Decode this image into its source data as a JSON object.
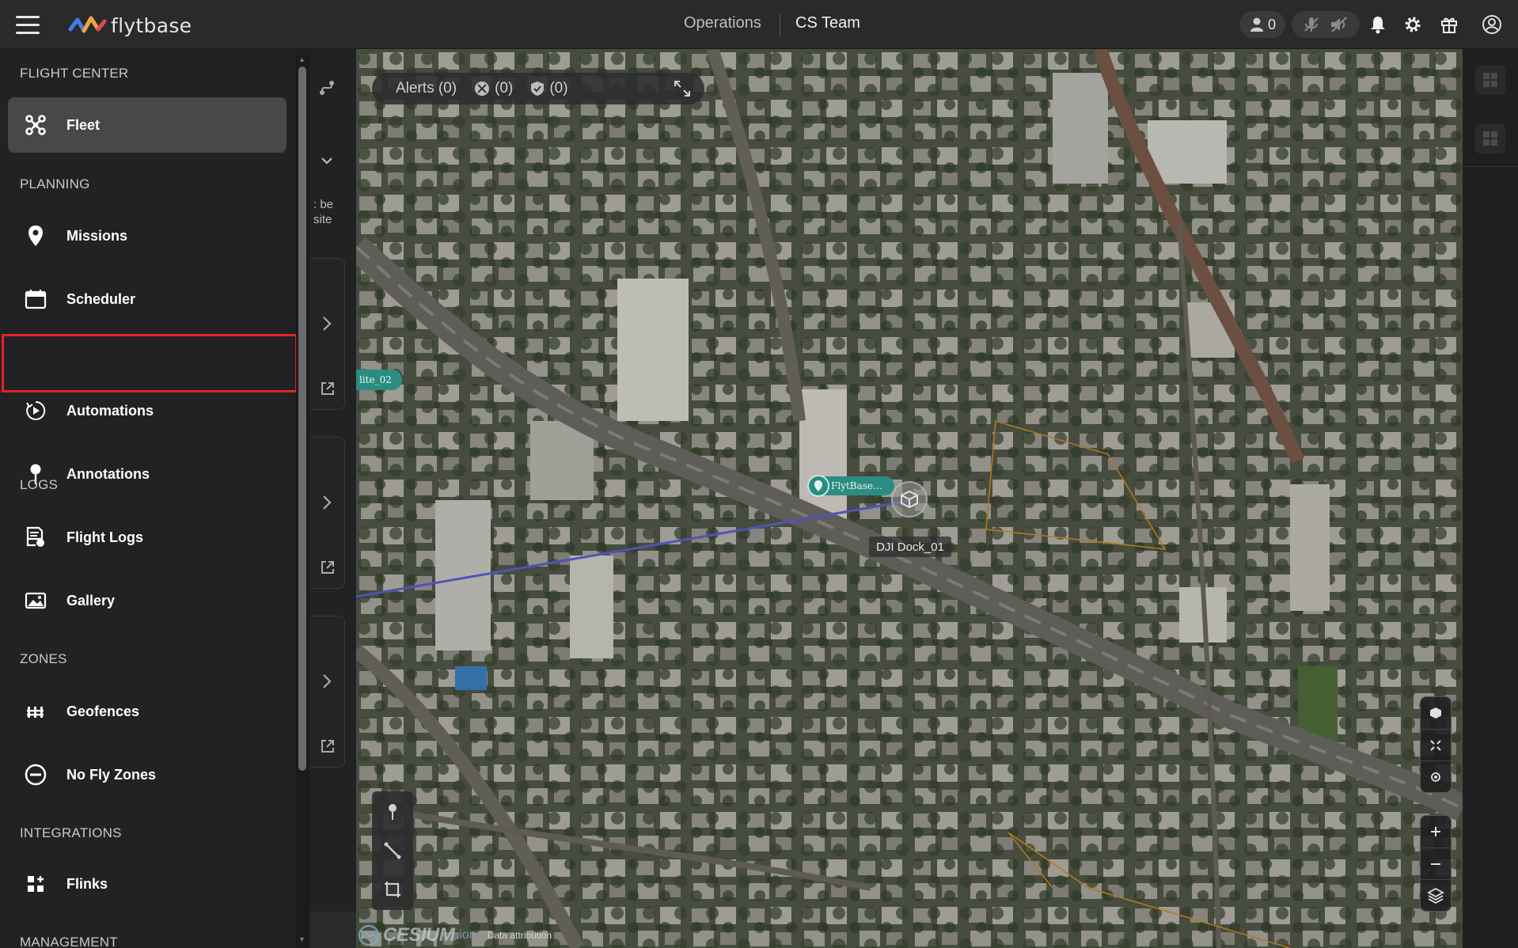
{
  "app": {
    "logo_text": "flytbase",
    "context_primary": "Operations",
    "context_secondary": "CS Team",
    "online_users": "0",
    "brand_colors": [
      "#3c7df0",
      "#f0a23c",
      "#e04a4a"
    ]
  },
  "sidebar": {
    "sections": [
      {
        "heading": "FLIGHT CENTER",
        "items": [
          {
            "label": "Fleet",
            "icon": "drone-icon",
            "active": true
          }
        ]
      },
      {
        "heading": "PLANNING",
        "items": [
          {
            "label": "Missions",
            "icon": "map-pin-icon"
          },
          {
            "label": "Scheduler",
            "icon": "calendar-icon"
          },
          {
            "label": "Automations",
            "icon": "automation-play-icon",
            "highlighted": true
          },
          {
            "label": "Annotations",
            "icon": "pushpin-icon"
          }
        ]
      },
      {
        "heading": "LOGS",
        "items": [
          {
            "label": "Flight Logs",
            "icon": "flight-log-icon"
          },
          {
            "label": "Gallery",
            "icon": "gallery-icon"
          }
        ]
      },
      {
        "heading": "ZONES",
        "items": [
          {
            "label": "Geofences",
            "icon": "geofence-icon"
          },
          {
            "label": "No Fly Zones",
            "icon": "no-entry-icon"
          }
        ]
      },
      {
        "heading": "INTEGRATIONS",
        "items": [
          {
            "label": "Flinks",
            "icon": "flinks-grid-icon"
          }
        ]
      },
      {
        "heading": "MANAGEMENT",
        "items": []
      }
    ],
    "highlight_color": "#e0242b"
  },
  "panel": {
    "partial_text_1": ": be",
    "partial_text_2": "site"
  },
  "map": {
    "alerts": {
      "label": "Alerts (0)",
      "drone_count": "(0)",
      "shield_count": "(0)"
    },
    "site_label": "lite_02",
    "flytbase_label": "FlytBase...",
    "dock_label": "DJI Dock_01",
    "geofence_color": "#c98a2a",
    "flight_path_color": "#5a5fd0",
    "attribution_brand": "CESIUM",
    "attribution_ion": "ion",
    "attribution_text": "Data attribution"
  }
}
